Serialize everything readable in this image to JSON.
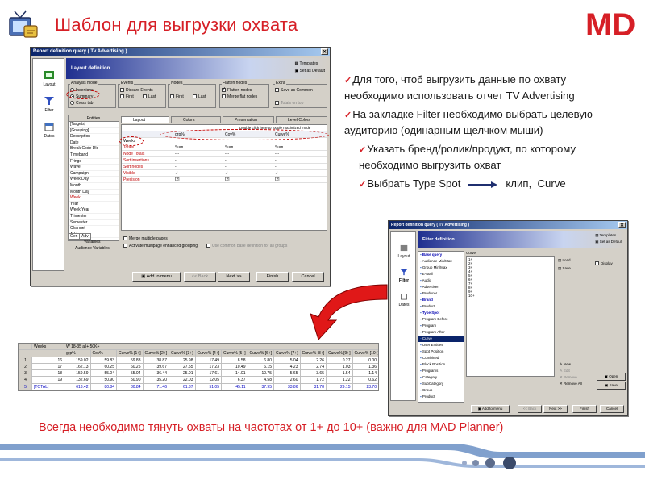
{
  "slide": {
    "title": "Шаблон для выгрузки охвата",
    "brand_logo_text": "MD",
    "accent_color": "#d61f26",
    "footer_note": "Всегда необходимо тянуть охваты на частотах от 1+ до 10+ (важно для MAD Planner)"
  },
  "bullets": [
    {
      "text": "Для того, чтоб выгрузить данные по охвату необходимо использовать отчет TV Advertising",
      "level": 0
    },
    {
      "text": "На закладке Filter необходимо выбрать целевую аудиторию (одинарным щелчком мыши)",
      "level": 0
    },
    {
      "text": "Указать бренд/ролик/продукт, по которому необходимо выгрузить охват",
      "level": 1
    },
    {
      "text": "Выбрать Type Spot",
      "tail_a": "клип,",
      "tail_b": "Curve",
      "level": 1
    }
  ],
  "dialog_main": {
    "title": "Report definition query ( Tv Advertising )",
    "header": "Layout definition",
    "templates": "Templates",
    "set_default": "Set as Default",
    "nav": [
      "Layout",
      "Filter",
      "Dates"
    ],
    "analysis_mode": {
      "label": "Analysis mode",
      "options": [
        "Insertions",
        "Summary",
        "Cross tab"
      ],
      "selected": "Summary"
    },
    "events": {
      "label": "Events",
      "discard": "Discard Events",
      "first": "First",
      "last": "Last"
    },
    "nodes": {
      "label": "Nodes",
      "first": "First",
      "last": "Last"
    },
    "flatten": {
      "label": "Flatten nodes",
      "flatten": "Flatten nodes",
      "merge": "Merge flat nodes"
    },
    "extra": {
      "label": "Extra",
      "save_common": "Save as Common",
      "totals_on_top": "Totals on top"
    },
    "entities_header": "Entities",
    "entities": [
      "[Targets]",
      "[Grouping]",
      "Description",
      "Date",
      "Break Code Dld",
      "Timeband",
      "Fringe",
      "Wave",
      "Campaign",
      "Week Day",
      "Month",
      "Month Day",
      "Week",
      "Year",
      "Week Year",
      "Trimester",
      "Semester",
      "Channel",
      "Ad+"
    ],
    "entities_red": [
      "Week"
    ],
    "gen_tabs": [
      "Gen",
      "Adv"
    ],
    "variables_label": "Variables",
    "audience_variables": "Audience Variables",
    "tabs": [
      "Layout",
      "Colors",
      "Presentation",
      "Level Colors"
    ],
    "double_click_hint": "Double click here to toggle maximized mode",
    "grid_header": [
      "grp%",
      "Cov%",
      "Curve%"
    ],
    "grid_week": "Weeks",
    "grid_rows": [
      {
        "label": "Totals",
        "v1": "Sum",
        "v2": "Sum",
        "v3": "Sum"
      },
      {
        "label": "Node Totals",
        "v1": "---",
        "v2": "---",
        "v3": "---"
      },
      {
        "label": "Sort insertions",
        "v1": "-",
        "v2": "-",
        "v3": "-"
      },
      {
        "label": "Sort nodes",
        "v1": "-",
        "v2": "-",
        "v3": "-"
      },
      {
        "label": "Visible",
        "v1": "✓",
        "v2": "✓",
        "v3": "✓"
      },
      {
        "label": "Precision",
        "v1": "[2]",
        "v2": "[2]",
        "v3": "[2]"
      }
    ],
    "merge_pages": "Merge multiple pages",
    "activate_grouping": "Activate multipage enhanced grouping",
    "use_common": "Use common base definition for all groups",
    "buttons": {
      "add": "Add to menu",
      "back": "<< Back",
      "next": "Next >>",
      "finish": "Finish",
      "cancel": "Cancel"
    }
  },
  "dialog_filter": {
    "title": "Report definition query ( Tv Advertising )",
    "header": "Filter definition",
    "templates": "Templates",
    "set_default": "Set as Default",
    "nav": [
      "Layout",
      "Filter",
      "Dates"
    ],
    "tree": [
      "Base query",
      "Audience Min/Max",
      "Group Min/Max",
      "E-Mail",
      "Audio",
      "Advertiser",
      "Producer",
      "Brand",
      "Product",
      "Type Spot",
      "Program Before",
      "Program",
      "Program After",
      "Curve",
      "User Entities",
      "Spot Position",
      "Combined",
      "Block Position",
      "Programs",
      "Category",
      "SubCategory",
      "Group",
      "Product"
    ],
    "curve_label": "Curve:",
    "curve_values": [
      "1+",
      "2+",
      "3+",
      "4+",
      "5+",
      "6+",
      "7+",
      "8+",
      "9+",
      "10+"
    ],
    "side": {
      "load": "Load",
      "save": "Save",
      "display": "Display",
      "new": "New",
      "edit": "Edit",
      "remove": "Remove",
      "remove_all": "Remove All",
      "open": "Open",
      "save2": "Save"
    },
    "buttons": {
      "add": "Add to menu",
      "back": "<< Back",
      "next": "Next >>",
      "finish": "Finish",
      "cancel": "Cancel"
    }
  },
  "results_table": {
    "header_top": [
      "Weeks",
      "W 18-35 all+ 50K+"
    ],
    "columns": [
      "grp%",
      "Cov%",
      "Curve% [1+]",
      "Curve% [2+]",
      "Curve% [3+]",
      "Curve% [4+]",
      "Curve% [5+]",
      "Curve% [6+]",
      "Curve% [7+]",
      "Curve% [8+]",
      "Curve% [9+]",
      "Curve% [10+]"
    ],
    "rows": [
      {
        "idx": "1",
        "week": "16",
        "values": [
          "159.02",
          "59.83",
          "59.83",
          "38.87",
          "25.98",
          "17.49",
          "8.58",
          "6.80",
          "5.04",
          "2.26",
          "0.27",
          "0.00"
        ]
      },
      {
        "idx": "2",
        "week": "17",
        "values": [
          "162.13",
          "60.25",
          "60.25",
          "39.67",
          "27.55",
          "17.23",
          "10.49",
          "6.15",
          "4.23",
          "2.74",
          "1.03",
          "1.36"
        ]
      },
      {
        "idx": "3",
        "week": "18",
        "values": [
          "159.59",
          "55.04",
          "55.04",
          "36.44",
          "25.01",
          "17.61",
          "14.01",
          "10.75",
          "5.65",
          "3.65",
          "1.54",
          "1.14"
        ]
      },
      {
        "idx": "4",
        "week": "19",
        "values": [
          "132.69",
          "50.90",
          "50.90",
          "35.20",
          "22.03",
          "12.05",
          "6.37",
          "4.58",
          "2.60",
          "1.72",
          "1.22",
          "0.62"
        ]
      },
      {
        "idx": "5",
        "week": "[TOTAL]",
        "values": [
          "613.42",
          "80.84",
          "80.84",
          "71.46",
          "61.37",
          "51.05",
          "45.11",
          "37.95",
          "33.86",
          "31.78",
          "29.15",
          "23.70"
        ]
      }
    ]
  }
}
